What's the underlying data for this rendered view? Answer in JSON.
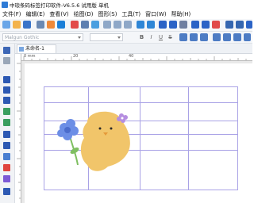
{
  "window": {
    "title": "中琅条码标签打印软件-V6.5.6 试用版 单机"
  },
  "menu": [
    "文件(F)",
    "编辑(E)",
    "查看(V)",
    "绘图(D)",
    "图形(S)",
    "工具(T)",
    "窗口(W)",
    "帮助(H)"
  ],
  "format": {
    "font_placeholder": "Malgun Gothic",
    "bold": "B",
    "italic": "I",
    "underline": "U",
    "strike": "S"
  },
  "tabs": [
    {
      "label": "未命名-1"
    }
  ],
  "ruler": {
    "label_0mm": "0 mm",
    "label_20": "20",
    "label_40": "40"
  },
  "colors": {
    "grid_lines": "#a9a2e6",
    "chick": "#f1c56a",
    "flower": "#6c8ee6",
    "stem": "#7fbf61"
  }
}
